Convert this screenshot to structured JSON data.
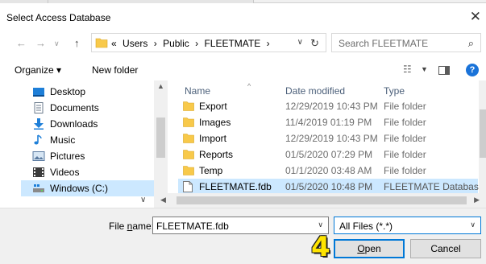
{
  "window": {
    "title": "Select Access Database",
    "close_glyph": "✕"
  },
  "address": {
    "crumbs": [
      "«",
      "Users",
      "›",
      "Public",
      "›",
      "FLEETMATE",
      "›"
    ],
    "search_placeholder": "Search FLEETMATE"
  },
  "toolbar": {
    "organize": "Organize ▾",
    "new_folder": "New folder"
  },
  "nav": {
    "items": [
      {
        "label": "Desktop",
        "icon": "desktop-icon"
      },
      {
        "label": "Documents",
        "icon": "documents-icon"
      },
      {
        "label": "Downloads",
        "icon": "downloads-icon"
      },
      {
        "label": "Music",
        "icon": "music-icon"
      },
      {
        "label": "Pictures",
        "icon": "pictures-icon"
      },
      {
        "label": "Videos",
        "icon": "videos-icon"
      },
      {
        "label": "Windows (C:)",
        "icon": "drive-icon"
      }
    ]
  },
  "files": {
    "headers": {
      "name": "Name",
      "date": "Date modified",
      "type": "Type"
    },
    "rows": [
      {
        "name": "Export",
        "date": "12/29/2019 10:43 PM",
        "type": "File folder"
      },
      {
        "name": "Images",
        "date": "11/4/2019 01:19 PM",
        "type": "File folder"
      },
      {
        "name": "Import",
        "date": "12/29/2019 10:43 PM",
        "type": "File folder"
      },
      {
        "name": "Reports",
        "date": "01/5/2020 07:29 PM",
        "type": "File folder"
      },
      {
        "name": "Temp",
        "date": "01/1/2020 03:48 AM",
        "type": "File folder"
      },
      {
        "name": "FLEETMATE.fdb",
        "date": "01/5/2020 10:48 PM",
        "type": "FLEETMATE Database"
      }
    ]
  },
  "bottom": {
    "filename_label_pre": "File ",
    "filename_label_u": "n",
    "filename_label_post": "ame:",
    "filename_value": "FLEETMATE.fdb",
    "filter_value": "All Files (*.*)",
    "open_u": "O",
    "open_rest": "pen",
    "cancel": "Cancel",
    "step_badge": "4"
  },
  "colors": {
    "accent": "#0078d7",
    "selection": "#cce8ff",
    "folder": "#f8c94a",
    "badge": "#ffe400"
  }
}
